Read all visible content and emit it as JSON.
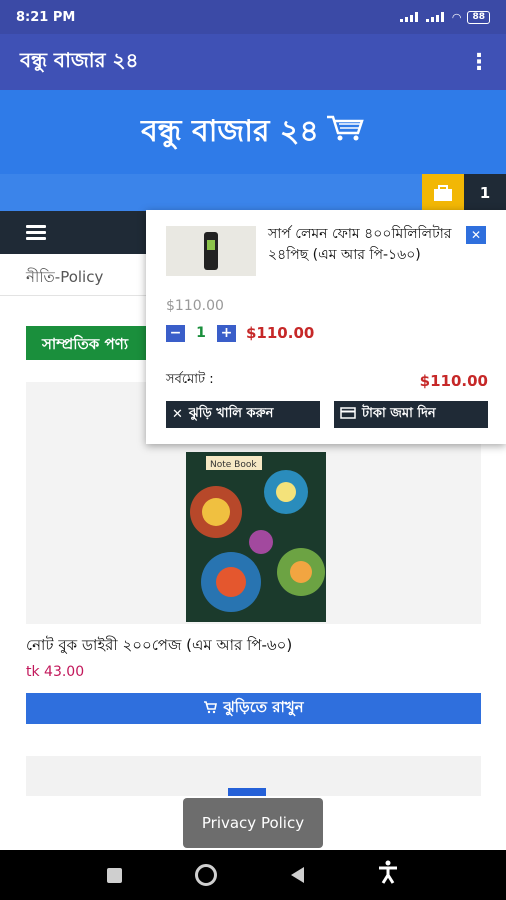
{
  "status": {
    "time": "8:21 PM",
    "battery": "88"
  },
  "app_bar": {
    "title": "বন্ধু বাজার ২৪"
  },
  "banner": {
    "title": "বন্ধু বাজার ২৪"
  },
  "cart_strip": {
    "count": "1"
  },
  "nav": {
    "policy_link": "নীতি-Policy"
  },
  "section": {
    "tag": "সাম্প্রতিক পণ্য"
  },
  "product": {
    "name": "নোট বুক ডাইরী ২০০পেজ (এম আর পি-৬০)",
    "price": "tk 43.00",
    "add_to_cart": "ঝুড়িতে রাখুন",
    "cover_text": "Note Book"
  },
  "toast": {
    "text": "Privacy Policy"
  },
  "cart_dropdown": {
    "item_name": "সার্প লেমন ফোম ৪০০মিলিলিটার ২৪পিছ (এম আর পি-১৬০)",
    "unit_price": "$110.00",
    "quantity": "1",
    "line_total": "$110.00",
    "total_label": "সর্বমোট :",
    "total_value": "$110.00",
    "empty_label": "ঝুড়ি খালি করুন",
    "checkout_label": "টাকা জমা দিন"
  },
  "colors": {
    "primary": "#3f51b5",
    "banner": "#2f7be8",
    "accent": "#f2b705",
    "dark": "#1f2a36",
    "price_red": "#c62828",
    "green": "#1a8f3c"
  }
}
